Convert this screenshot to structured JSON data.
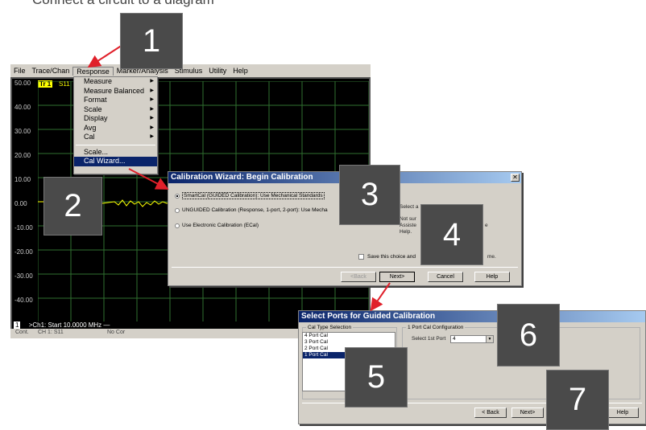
{
  "caption": "Connect a circuit to a diagram",
  "menubar": [
    "File",
    "Trace/Chan",
    "Response",
    "Marker/Analysis",
    "Stimulus",
    "Utility",
    "Help"
  ],
  "plot": {
    "trace_tab": "Tr 1",
    "trace_param": "S11",
    "y_labels": [
      "50.00",
      "40.00",
      "30.00",
      "20.00",
      "10.00",
      "0.00",
      "-10.00",
      "-20.00",
      "-30.00",
      "-40.00",
      "-50.00"
    ],
    "channel_num": "1",
    "bottom_text": ">Ch1: Start  10.0000 MHz —"
  },
  "statusbar": {
    "mode": "Cont.",
    "channel": "CH 1:  S11",
    "correction": "No Cor"
  },
  "response_menu": {
    "items": [
      "Measure",
      "Measure Balanced",
      "Format",
      "Scale",
      "Display",
      "Avg",
      "Cal"
    ],
    "items2": [
      "Scale...",
      "Cal Wizard..."
    ]
  },
  "dialog1": {
    "title": "Calibration Wizard: Begin Calibration",
    "options": [
      "SmartCal (GUIDED Calibration): Use Mechanical Standards",
      "UNGUIDED Calibration (Response, 1-port, 2-port): Use Mecha",
      "Use Electronic Calibration (ECal)"
    ],
    "right_text_1": "Select a",
    "right_text_2": "Not sur",
    "right_text_3": "Assiste",
    "right_text_4": "Help.",
    "right_text_5": "e",
    "checkbox_label": "Save this choice and",
    "checkbox_tail": "me.",
    "buttons": {
      "back": "<Back",
      "next": "Next>",
      "cancel": "Cancel",
      "help": "Help"
    }
  },
  "dialog2": {
    "title": "Select Ports for Guided Calibration",
    "cal_type_label": "Cal Type Selection",
    "cal_types": [
      "4 Port Cal",
      "3 Port Cal",
      "2 Port Cal",
      "1 Port Cal"
    ],
    "config_label": "1 Port Cal Configuration",
    "port_label": "Select 1st Port",
    "port_value": "4",
    "buttons": {
      "back": "< Back",
      "next": "Next>",
      "help": "Help"
    }
  },
  "badges": [
    "1",
    "2",
    "3",
    "4",
    "5",
    "6",
    "7"
  ],
  "colors": {
    "arrow": "#e0202a",
    "badge": "#4a4a4a",
    "titlebar": "#0a246a",
    "trace": "#ffff00"
  }
}
